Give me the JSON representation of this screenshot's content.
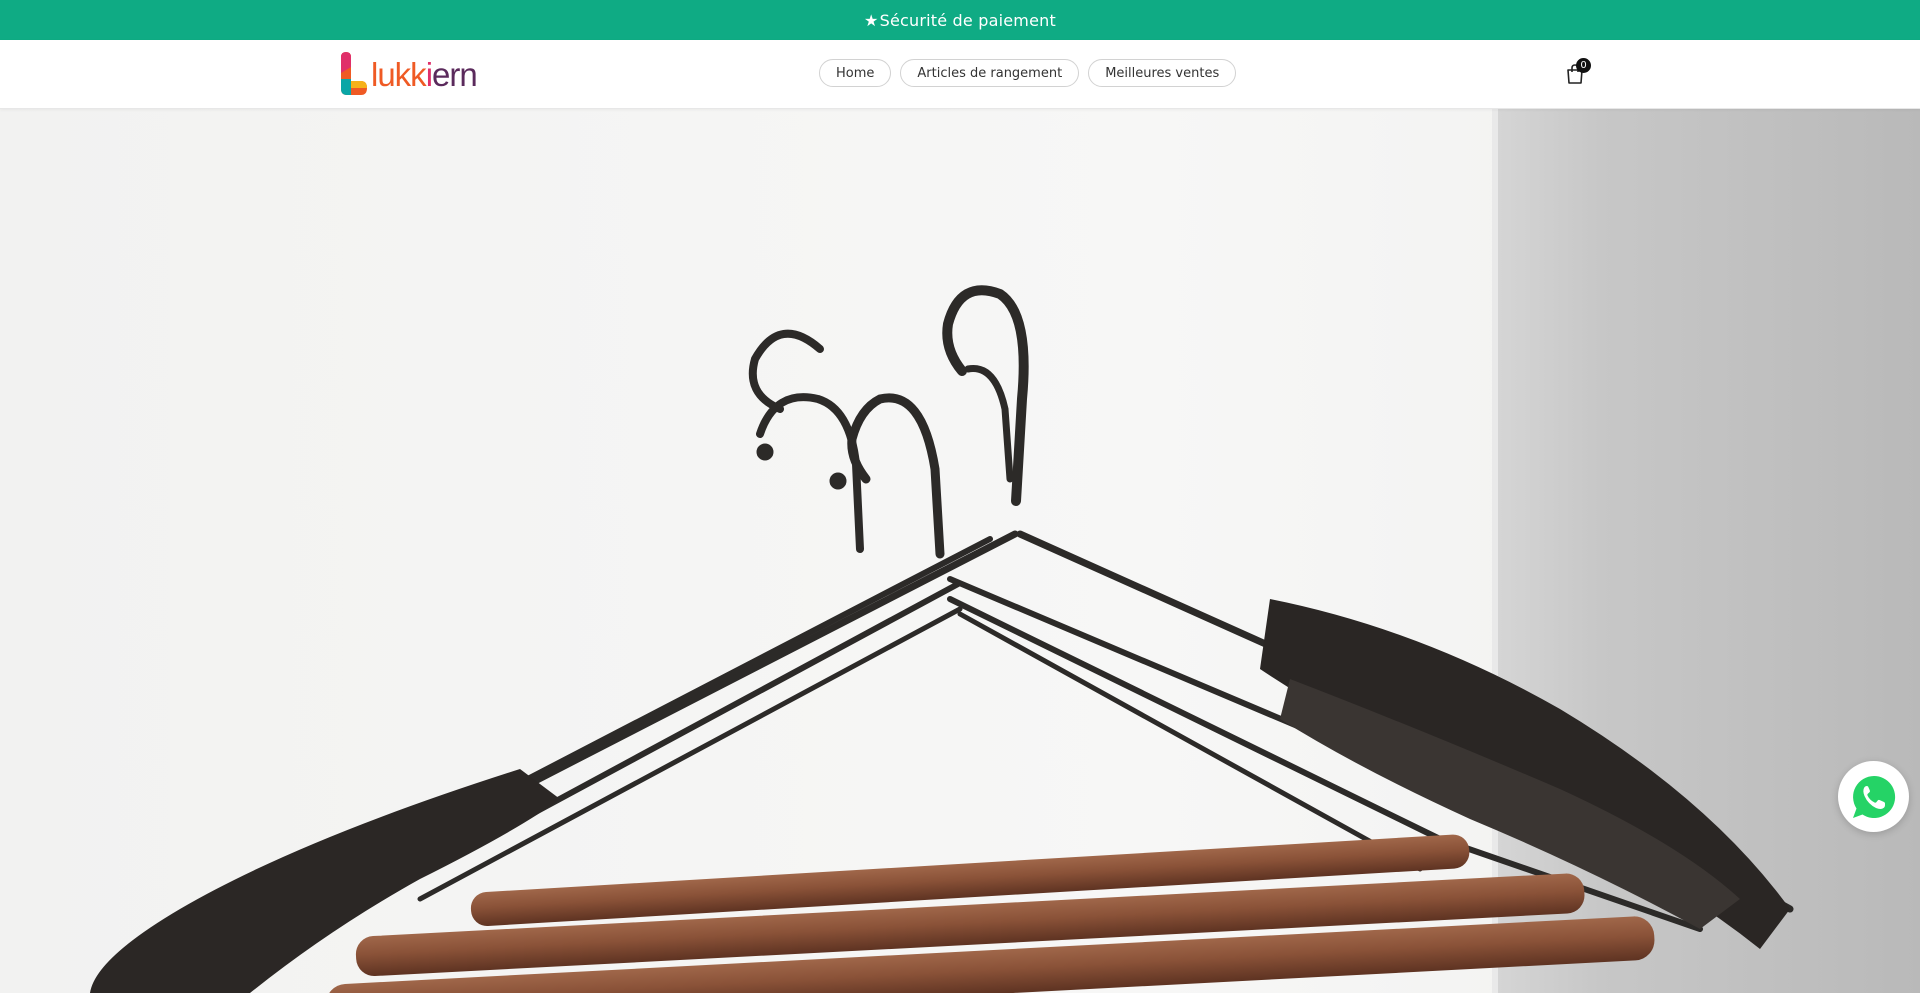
{
  "announcement": {
    "star": "★",
    "text": "Sécurité de paiement"
  },
  "header": {
    "logo": {
      "part1": "lukk",
      "part2": "i",
      "part3": "ern"
    },
    "nav": [
      {
        "label": "Home"
      },
      {
        "label": "Articles de rangement"
      },
      {
        "label": "Meilleures ventes"
      }
    ],
    "cart": {
      "count": "0",
      "icon": "shopping-bag-icon"
    }
  },
  "hero": {
    "image": "hangers-photo"
  },
  "floating": {
    "icon": "whatsapp-icon"
  },
  "colors": {
    "announcement_bg": "#0fab84",
    "whatsapp_green": "#25d366",
    "logo_orange": "#ef5a24",
    "logo_pink": "#e02f6a",
    "logo_purple": "#5b2a5c"
  }
}
